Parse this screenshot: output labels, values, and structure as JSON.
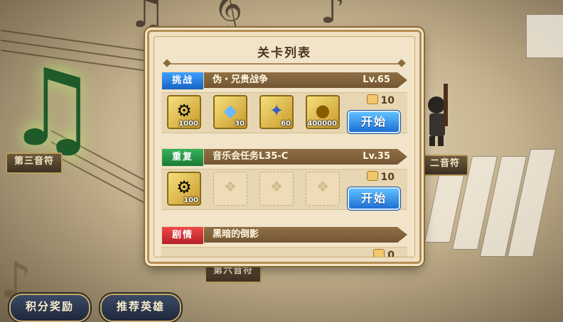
{
  "dialog": {
    "title": "关卡列表",
    "stages": [
      {
        "tag": "挑战",
        "tag_color": "blue",
        "name": "伪・兄贵战争",
        "level": "Lv.65",
        "rewards": [
          {
            "icon": "gear-coin-icon",
            "qty": "1000"
          },
          {
            "icon": "rainbow-gem-icon",
            "qty": "30"
          },
          {
            "icon": "star-key-icon",
            "qty": "60"
          },
          {
            "icon": "gold-coin-icon",
            "qty": "400000"
          }
        ],
        "stamina": "10",
        "start_label": "开始"
      },
      {
        "tag": "重复",
        "tag_color": "green",
        "name": "音乐会任务L35-C",
        "level": "Lv.35",
        "rewards": [
          {
            "icon": "gear-coin-icon",
            "qty": "100"
          }
        ],
        "stamina": "10",
        "start_label": "开始"
      },
      {
        "tag": "剧情",
        "tag_color": "red",
        "name": "黑暗的倒影",
        "level": "",
        "stamina": "0"
      }
    ]
  },
  "map": {
    "left_label": "第三音符",
    "right_label": "二音符",
    "bottom_label": "第六音符"
  },
  "bottom_buttons": {
    "points_reward": "积分奖励",
    "recommend_heroes": "推荐英雄"
  },
  "colors": {
    "tag_blue": "#1f7fe6",
    "tag_green": "#25953f",
    "tag_red": "#d32f2f",
    "start_button": "#2a8bea"
  }
}
